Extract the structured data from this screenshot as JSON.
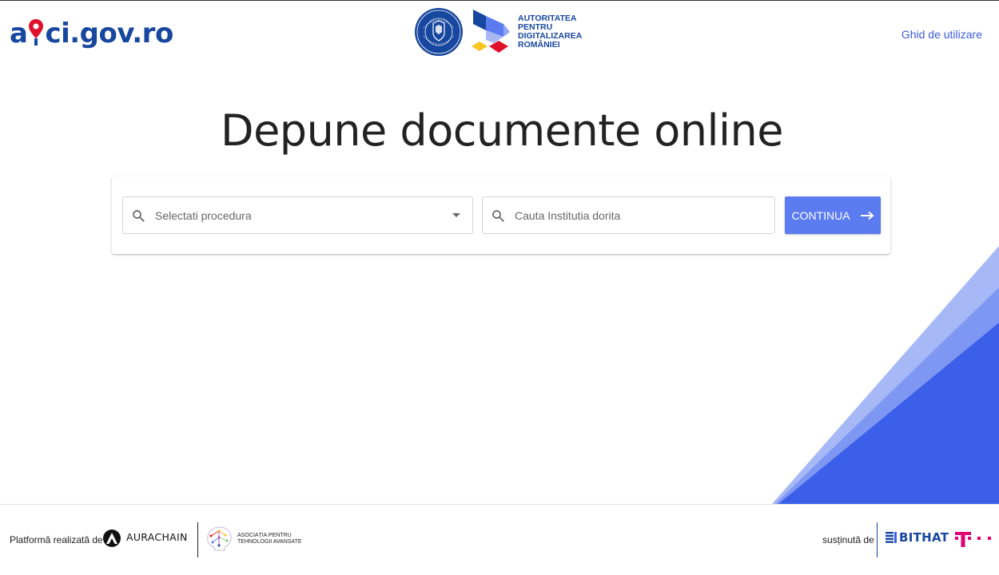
{
  "header": {
    "logo_prefix": "a",
    "logo_suffix": "ci.gov.ro",
    "adr_lines": [
      "AUTORITATEA",
      "PENTRU",
      "DIGITALIZAREA",
      "ROMÂNIEI"
    ],
    "guide_link": "Ghid de utilizare"
  },
  "main": {
    "title": "Depune documente online",
    "procedure_placeholder": "Selectati procedura",
    "institution_placeholder": "Cauta Institutia dorita",
    "continue_label": "CONTINUA"
  },
  "footer": {
    "made_by": "Platformă realizată de",
    "aurachain": "AURACHAIN",
    "apta_line1": "ASOCIAȚIA PENTRU",
    "apta_line2": "TEHNOLOGII AVANSATE",
    "supported_by": "susținută de",
    "bithat": "BITHAT"
  },
  "colors": {
    "brand_blue": "#17479e",
    "link_blue": "#3b5bdb",
    "button_blue": "#5b7bf0",
    "deco_blue_light": "#a6b8f6",
    "deco_blue_mid": "#7d97f3",
    "deco_blue_dark": "#3b5fe8",
    "accent_red": "#e0112b",
    "telekom_magenta": "#e20074"
  },
  "icons": {
    "search": "search-icon",
    "dropdown": "chevron-down-icon",
    "continue": "arrow-right-icon"
  }
}
